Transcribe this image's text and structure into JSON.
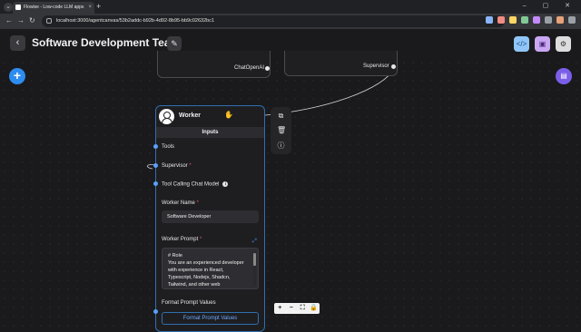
{
  "browser": {
    "tab_title": "Flowise - Low-code LLM apps",
    "tab_close": "×",
    "new_tab": "+",
    "url": "localhost:3000/agentcanvas/53b2addc-b92b-4d92-8b95-bb9c02632bc1",
    "window_controls": "– ▢ ✕",
    "extension_colors": [
      "#8ab4f8",
      "#f28b82",
      "#fdd663",
      "#81c995",
      "#c58af9",
      "#9aa0a6",
      "#e8a27a",
      "#9aa0a6"
    ]
  },
  "header": {
    "title": "Software Development Team",
    "back_glyph": "‹",
    "edit_glyph": "✎",
    "code_glyph": "</>",
    "save_glyph": "▣",
    "settings_glyph": "⚙",
    "colors": {
      "code": "#8fc6f7",
      "save": "#c9a6f2",
      "settings": "#dddddd"
    }
  },
  "canvas": {
    "add_glyph": "+",
    "chat_glyph": "▤",
    "chatopenai_label": "ChatOpenAI",
    "supervisor_node_label": "Supervisor"
  },
  "worker": {
    "title": "Worker",
    "inputs_label": "Inputs",
    "tools_label": "Tools",
    "supervisor_label": "Supervisor",
    "required_mark": "*",
    "chat_model_label": "Tool Calling Chat Model",
    "info_glyph": "i",
    "worker_name_label": "Worker Name",
    "worker_name_value": "Software Developer",
    "worker_prompt_label": "Worker Prompt",
    "prompt_lines": [
      "# Role",
      "You are an experienced developer",
      "with experience in React,",
      "Typescript, Nodejs, Shadcn,",
      "Tailwind, and other web"
    ],
    "expand_glyph": "⤢",
    "format_prompt_label": "Format Prompt Values",
    "format_prompt_button": "Format Prompt Values"
  },
  "node_toolbar": {
    "copy_glyph": "⧉",
    "delete_glyph": "🗑",
    "info_glyph": "ⓘ"
  },
  "zoom_controls": {
    "zoom_in": "+",
    "zoom_out": "−",
    "fit": "⛶",
    "lock": "🔒"
  }
}
